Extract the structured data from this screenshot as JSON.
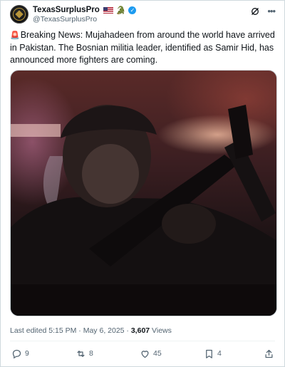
{
  "tweet": {
    "display_name": "TexasSurplusPro",
    "handle": "@TexasSurplusPro",
    "text": "Breaking News: Mujahadeen from around the world have arrived in Pakistan. The Bosnian militia leader, identified as Samir Hid, has announced more fighters are coming.",
    "siren_icon": "🚨",
    "verified_color": "#1d9bf0"
  },
  "meta": {
    "last_edited": "Last edited 5:15 PM · May 6, 2025 · ",
    "views_count": "3,607",
    "views_label": " Views"
  },
  "actions": {
    "replies": "9",
    "reposts": "8",
    "likes": "45",
    "bookmarks": "4"
  }
}
